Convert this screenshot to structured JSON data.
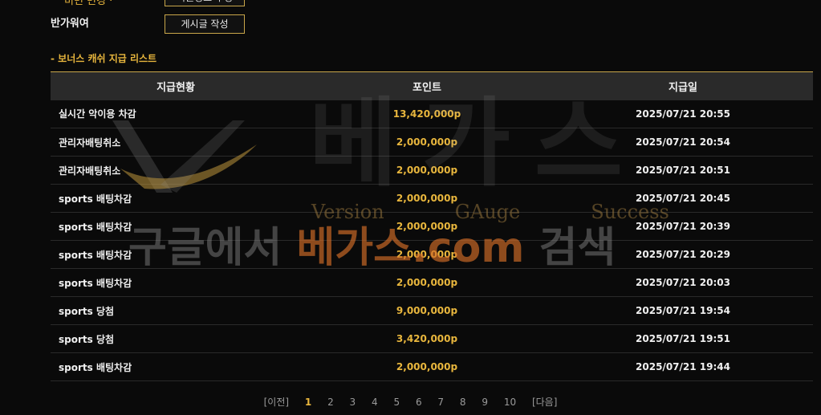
{
  "top": {
    "cut_label": "비번 변경 ·",
    "cut_button": "회원정보 수정",
    "user_label": "반가워여",
    "write_button": "게시글 작성"
  },
  "section_title": "- 보너스 캐쉬 지급 리스트",
  "table": {
    "headers": [
      "지급현황",
      "포인트",
      "지급일"
    ],
    "rows": [
      {
        "status": "실시간 악이용 차감",
        "points": "13,420,000p",
        "date": "2025/07/21 20:55"
      },
      {
        "status": "관리자배팅취소",
        "points": "2,000,000p",
        "date": "2025/07/21 20:54"
      },
      {
        "status": "관리자배팅취소",
        "points": "2,000,000p",
        "date": "2025/07/21 20:51"
      },
      {
        "status": "sports 배팅차감",
        "points": "2,000,000p",
        "date": "2025/07/21 20:45"
      },
      {
        "status": "sports 배팅차감",
        "points": "2,000,000p",
        "date": "2025/07/21 20:39"
      },
      {
        "status": "sports 배팅차감",
        "points": "2,000,000p",
        "date": "2025/07/21 20:29"
      },
      {
        "status": "sports 배팅차감",
        "points": "2,000,000p",
        "date": "2025/07/21 20:03"
      },
      {
        "status": "sports 당첨",
        "points": "9,000,000p",
        "date": "2025/07/21 19:54"
      },
      {
        "status": "sports 당첨",
        "points": "3,420,000p",
        "date": "2025/07/21 19:51"
      },
      {
        "status": "sports 배팅차감",
        "points": "2,000,000p",
        "date": "2025/07/21 19:44"
      }
    ]
  },
  "pagination": {
    "prev": "[이전]",
    "pages": [
      "1",
      "2",
      "3",
      "4",
      "5",
      "6",
      "7",
      "8",
      "9",
      "10"
    ],
    "current": "1",
    "next": "[다음]"
  },
  "watermark": {
    "big": "베가스",
    "sub": [
      "Version",
      "GAuge",
      "Success"
    ],
    "search_prefix": "구글에서 ",
    "search_domain": "베가스.com",
    "search_suffix": " 검색"
  },
  "colors": {
    "accent": "#e8b63d",
    "border_gold": "#c9a74a",
    "header_bg": "#2a2a2a",
    "page_bg": "#0a0a0a"
  }
}
